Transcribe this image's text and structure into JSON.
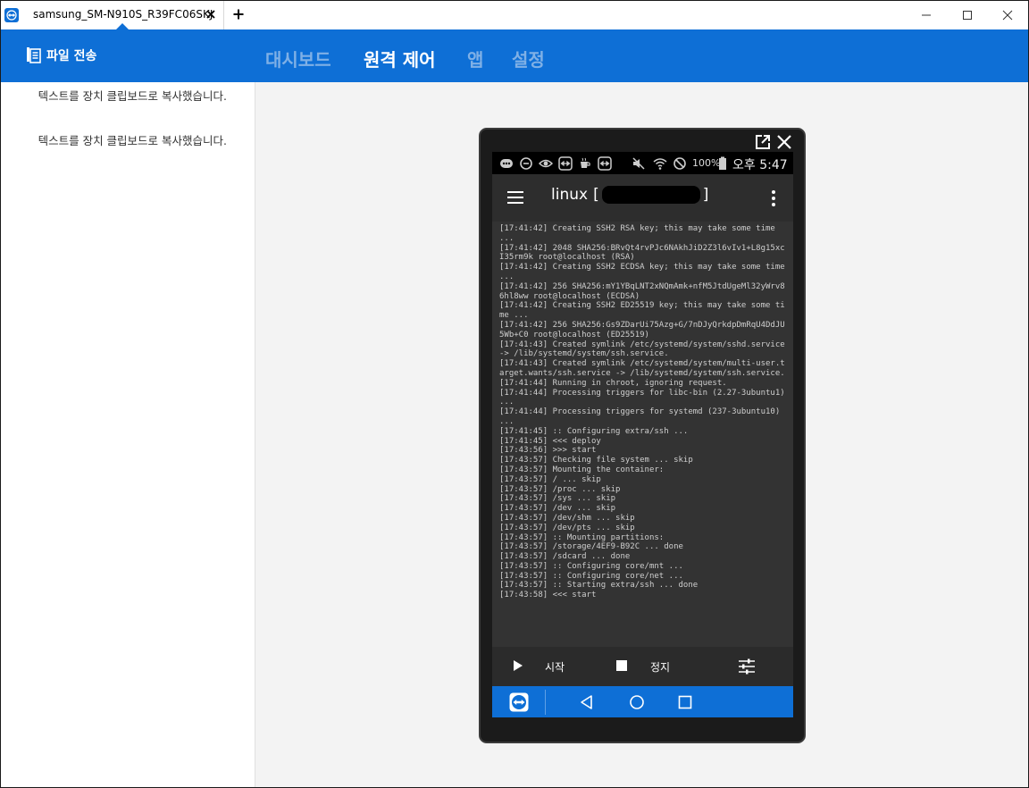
{
  "window": {
    "tab_title": "samsung_SM-N910S_R39FC06SKJ",
    "icons": {
      "tab_logo": "teamviewer-logo-icon",
      "tab_close": "close-icon",
      "new_tab": "plus-icon",
      "minimize": "minimize-icon",
      "maximize": "maximize-icon",
      "close": "close-icon"
    }
  },
  "header": {
    "file_transfer_label": "파일 전송",
    "file_transfer_icon": "file-transfer-icon",
    "tabs": [
      {
        "label": "대시보드",
        "active": false
      },
      {
        "label": "원격 제어",
        "active": true
      },
      {
        "label": "앱",
        "active": false
      },
      {
        "label": "설정",
        "active": false
      }
    ],
    "colors": {
      "bar": "#0e6fd6",
      "active": "#ffffff",
      "inactive": "#7fb0e6"
    }
  },
  "sidebar": {
    "messages": [
      "텍스트를 장치 클립보드로 복사했습니다.",
      "텍스트를 장치 클립보드로 복사했습니다."
    ]
  },
  "phone": {
    "status_bar": {
      "battery": "100%",
      "time": "오후 5:47"
    },
    "app_bar": {
      "title": "linux",
      "bracket_open": "[",
      "bracket_close": "]"
    },
    "console_lines": [
      "[17:41:42] Creating SSH2 RSA key; this may take some time ...",
      "[17:41:42] 2048 SHA256:BRvQt4rvPJc6NAkhJiD2Z3l6vIv1+L8g15xcI35rm9k root@localhost (RSA)",
      "[17:41:42] Creating SSH2 ECDSA key; this may take some time ...",
      "[17:41:42] 256 SHA256:mY1YBqLNT2xNQmAmk+nfM5JtdUgeMl32yWrv86hl8ww root@localhost (ECDSA)",
      "[17:41:42] Creating SSH2 ED25519 key; this may take some time ...",
      "[17:41:42] 256 SHA256:Gs9ZDarUi75Azg+G/7nDJyQrkdpDmRqU4DdJU5Wb+C0 root@localhost (ED25519)",
      "[17:41:43] Created symlink /etc/systemd/system/sshd.service -> /lib/systemd/system/ssh.service.",
      "[17:41:43] Created symlink /etc/systemd/system/multi-user.target.wants/ssh.service -> /lib/systemd/system/ssh.service.",
      "[17:41:44] Running in chroot, ignoring request.",
      "[17:41:44] Processing triggers for libc-bin (2.27-3ubuntu1) ...",
      "[17:41:44] Processing triggers for systemd (237-3ubuntu10) ...",
      "[17:41:45] :: Configuring extra/ssh ...",
      "[17:41:45] <<< deploy",
      "[17:43:56] >>> start",
      "[17:43:57] Checking file system ... skip",
      "[17:43:57] Mounting the container:",
      "[17:43:57] / ... skip",
      "[17:43:57] /proc ... skip",
      "[17:43:57] /sys ... skip",
      "[17:43:57] /dev ... skip",
      "[17:43:57] /dev/shm ... skip",
      "[17:43:57] /dev/pts ... skip",
      "[17:43:57] :: Mounting partitions:",
      "[17:43:57] /storage/4EF9-B92C ... done",
      "[17:43:57] /sdcard ... done",
      "[17:43:57] :: Configuring core/mnt ...",
      "[17:43:57] :: Configuring core/net ...",
      "[17:43:57] :: Starting extra/ssh ... done",
      "[17:43:58] <<< start"
    ],
    "controls": {
      "start_label": "시작",
      "stop_label": "정지"
    }
  }
}
